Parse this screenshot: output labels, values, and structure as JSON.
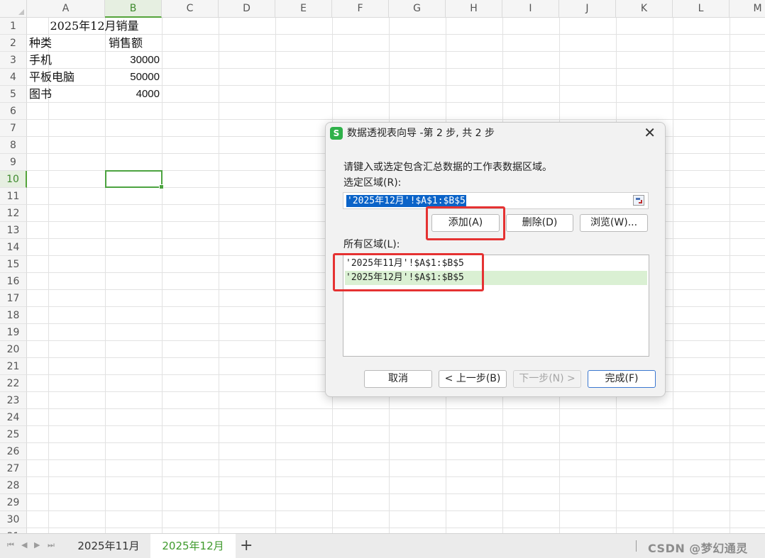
{
  "spreadsheet": {
    "columns": [
      "A",
      "B",
      "C",
      "D",
      "E",
      "F",
      "G",
      "H",
      "I",
      "J",
      "K",
      "L",
      "M"
    ],
    "selected_column": "B",
    "rows": [
      "1",
      "2",
      "3",
      "4",
      "5",
      "6",
      "7",
      "8",
      "9",
      "10",
      "11",
      "12",
      "13",
      "14",
      "15",
      "16",
      "17",
      "18",
      "19",
      "20",
      "21",
      "22",
      "23",
      "24",
      "25",
      "26",
      "27",
      "28",
      "29",
      "30",
      "31"
    ],
    "selected_row": "10",
    "cells": {
      "title": "2025年12月销量",
      "header_a": "种类",
      "header_b": "销售额",
      "r3_a": "手机",
      "r3_b": "30000",
      "r4_a": "平板电脑",
      "r4_b": "50000",
      "r5_a": "图书",
      "r5_b": "4000"
    }
  },
  "sheet_tabs": {
    "tabs": [
      {
        "label": "2025年11月",
        "active": false
      },
      {
        "label": "2025年12月",
        "active": true
      }
    ],
    "add_tab": "+",
    "nav": [
      "⏮",
      "◀",
      "▶",
      "⏭"
    ]
  },
  "watermark": "CSDN @梦幻通灵",
  "dialog": {
    "app_icon": "wps-spreadsheet-icon",
    "title": "数据透视表向导 -第 2 步, 共 2 步",
    "close_glyph": "✕",
    "instruction": "请键入或选定包含汇总数据的工作表数据区域。",
    "selected_range_label": "选定区域(R):",
    "selected_range_value": "'2025年12月'!$A$1:$B$5",
    "buttons": {
      "add": "添加(A)",
      "delete": "删除(D)",
      "browse": "浏览(W)..."
    },
    "all_ranges_label": "所有区域(L):",
    "all_ranges": [
      {
        "text": "'2025年11月'!$A$1:$B$5",
        "selected": false
      },
      {
        "text": "'2025年12月'!$A$1:$B$5",
        "selected": true
      }
    ],
    "footer_buttons": {
      "cancel": "取消",
      "back": "< 上一步(B)",
      "next": "下一步(N) >",
      "finish": "完成(F)"
    },
    "next_disabled": true
  },
  "annotations": {
    "highlight_color": "#e53232"
  }
}
